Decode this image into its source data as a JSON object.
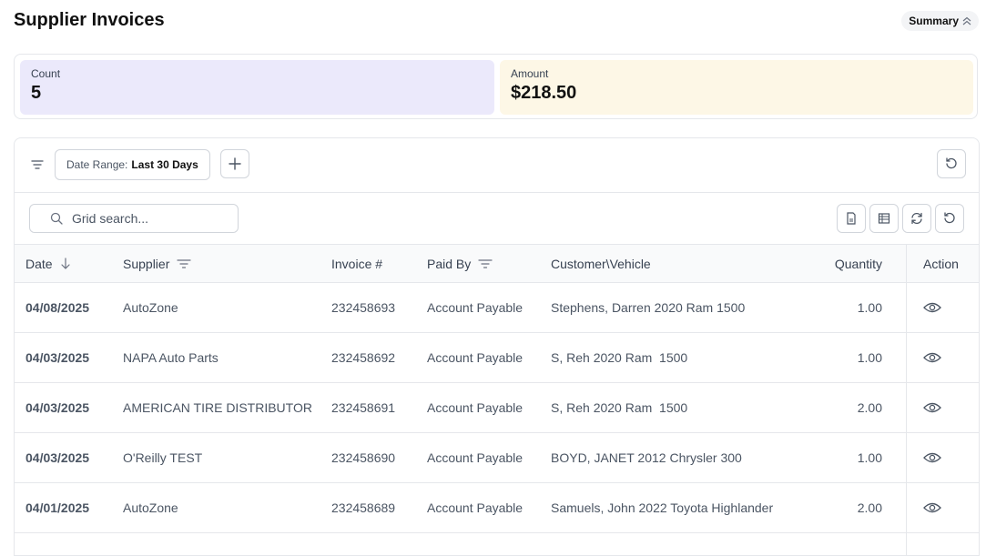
{
  "page": {
    "title": "Supplier Invoices",
    "summary_toggle": "Summary"
  },
  "summary": {
    "count_label": "Count",
    "count_value": "5",
    "amount_label": "Amount",
    "amount_value": "$218.50"
  },
  "filters": {
    "chip_key": "Date Range:",
    "chip_value": "Last 30 Days"
  },
  "search": {
    "placeholder": "Grid search..."
  },
  "table": {
    "columns": {
      "date": "Date",
      "supplier": "Supplier",
      "invoice": "Invoice #",
      "paid_by": "Paid By",
      "customer": "Customer\\Vehicle",
      "quantity": "Quantity",
      "action": "Action"
    },
    "rows": [
      {
        "date": "04/08/2025",
        "supplier": "AutoZone",
        "invoice": "232458693",
        "paid_by": "Account Payable",
        "customer": "Stephens, Darren 2020 Ram 1500",
        "quantity": "1.00"
      },
      {
        "date": "04/03/2025",
        "supplier": "NAPA Auto Parts",
        "invoice": "232458692",
        "paid_by": "Account Payable",
        "customer": "S, Reh 2020 Ram  1500",
        "quantity": "1.00"
      },
      {
        "date": "04/03/2025",
        "supplier": "AMERICAN TIRE DISTRIBUTOR",
        "invoice": "232458691",
        "paid_by": "Account Payable",
        "customer": "S, Reh 2020 Ram  1500",
        "quantity": "2.00"
      },
      {
        "date": "04/03/2025",
        "supplier": "O'Reilly TEST",
        "invoice": "232458690",
        "paid_by": "Account Payable",
        "customer": "BOYD, JANET 2012 Chrysler 300",
        "quantity": "1.00"
      },
      {
        "date": "04/01/2025",
        "supplier": "AutoZone",
        "invoice": "232458689",
        "paid_by": "Account Payable",
        "customer": "Samuels, John 2022 Toyota Highlander",
        "quantity": "2.00"
      }
    ]
  },
  "colors": {
    "count_bg": "#ebe9fb",
    "amount_bg": "#fdf7e6",
    "border": "#e5e7eb"
  },
  "icons": [
    "chevrons-up-icon",
    "filter-lines-icon",
    "plus-icon",
    "reset-icon",
    "search-icon",
    "export-pdf-icon",
    "export-sheet-icon",
    "refresh-icon",
    "sort-down-icon",
    "column-filter-icon",
    "eye-icon"
  ]
}
